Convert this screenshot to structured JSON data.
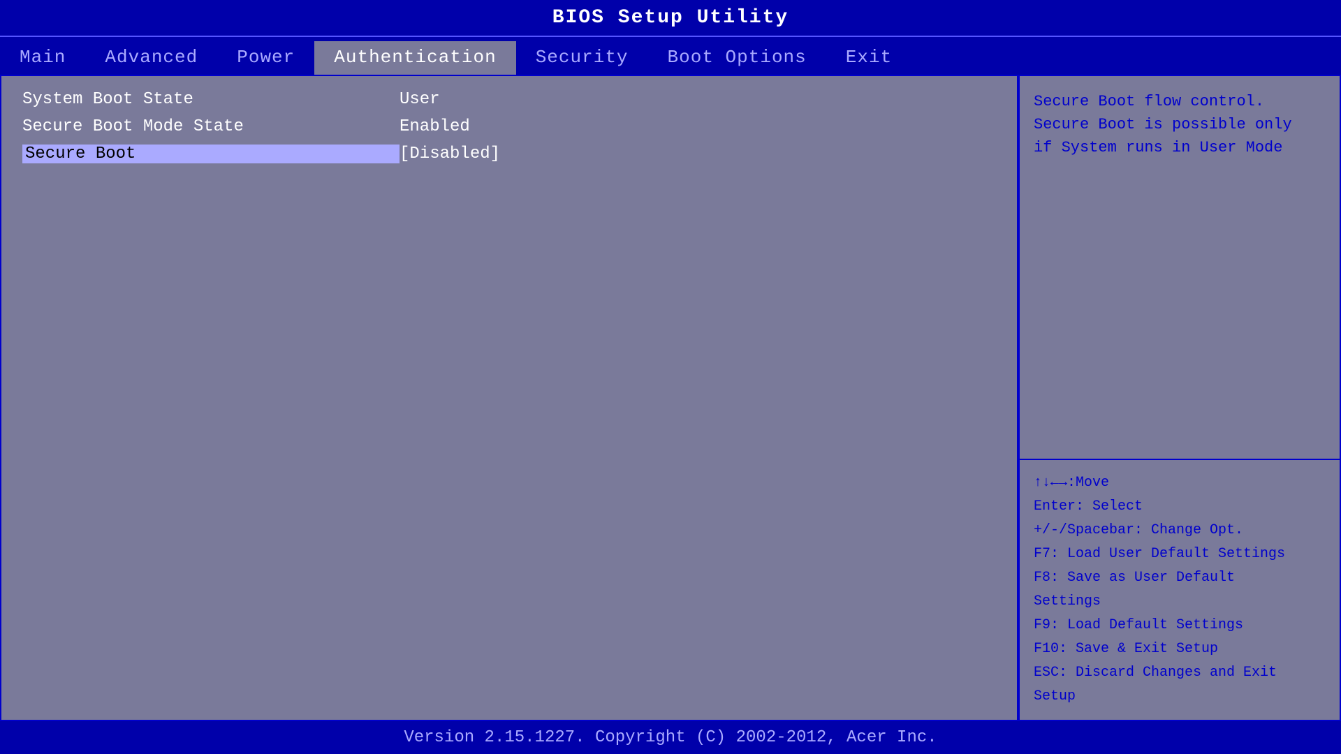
{
  "title": "BIOS Setup Utility",
  "menu": {
    "items": [
      {
        "label": "Main",
        "active": false
      },
      {
        "label": "Advanced",
        "active": false
      },
      {
        "label": "Power",
        "active": false
      },
      {
        "label": "Authentication",
        "active": true
      },
      {
        "label": "Security",
        "active": false
      },
      {
        "label": "Boot Options",
        "active": false
      },
      {
        "label": "Exit",
        "active": false
      }
    ]
  },
  "settings": [
    {
      "label": "System Boot State",
      "value": "User",
      "bracketed": false,
      "selected": false
    },
    {
      "label": "Secure Boot Mode State",
      "value": "Enabled",
      "bracketed": false,
      "selected": false
    },
    {
      "label": "Secure Boot",
      "value": "[Disabled]",
      "bracketed": true,
      "selected": true
    }
  ],
  "help": {
    "description_line1": "Secure Boot flow control.",
    "description_line2": "Secure Boot is possible only",
    "description_line3": "if System runs in User Mode"
  },
  "key_help": {
    "move": "↑↓←→:Move",
    "enter": "Enter: Select",
    "change": "+/-/Spacebar: Change Opt.",
    "f7": "F7: Load User Default Settings",
    "f8_line1": "F8: Save as User Default",
    "f8_line2": "Settings",
    "f9": "F9: Load Default Settings",
    "f10": "F10: Save & Exit Setup",
    "esc": "ESC: Discard Changes and Exit",
    "esc_line2": "Setup"
  },
  "footer": "Version 2.15.1227. Copyright (C) 2002-2012, Acer Inc."
}
